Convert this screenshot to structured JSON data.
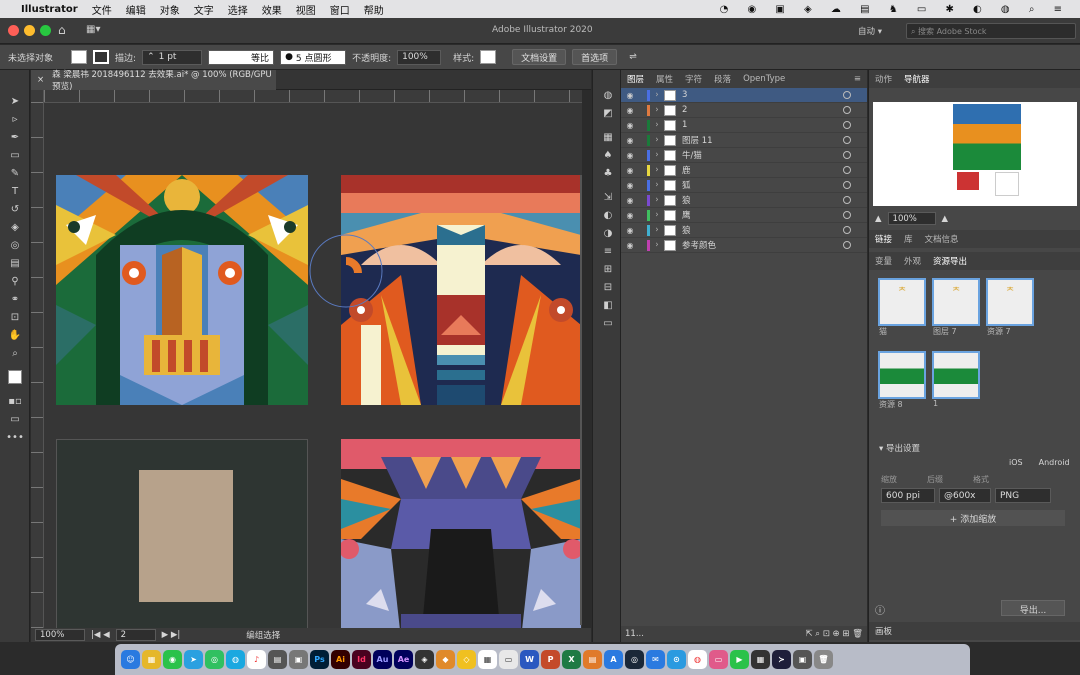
{
  "menubar": {
    "app_name": "Illustrator",
    "items": [
      "文件",
      "编辑",
      "对象",
      "文字",
      "选择",
      "效果",
      "视图",
      "窗口",
      "帮助"
    ]
  },
  "window": {
    "title": "Adobe Illustrator 2020",
    "workspace": "自动",
    "search_placeholder": "搜索 Adobe Stock"
  },
  "control_bar": {
    "selection": "未选择对象",
    "stroke_label": "描边:",
    "stroke_value": "1 pt",
    "stroke_style": "等比",
    "brush": "5 点圆形",
    "opacity_label": "不透明度:",
    "opacity_value": "100%",
    "style_label": "样式:",
    "doc_settings": "文档设置",
    "preferences": "首选项"
  },
  "document_tab": {
    "title": "森 梁晨祎 2018496112 去效果.ai* @ 100% (RGB/GPU 预览)"
  },
  "status_bar": {
    "zoom": "100%",
    "artboard": "2",
    "status": "编组选择"
  },
  "layers_panel": {
    "tabs": [
      "图层",
      "属性",
      "字符",
      "段落",
      "OpenType"
    ],
    "layers": [
      {
        "name": "3",
        "color": "#4a6fe3"
      },
      {
        "name": "2",
        "color": "#e07a40"
      },
      {
        "name": "1",
        "color": "#1a7a3a"
      },
      {
        "name": "图层 11",
        "color": "#1a7a3a"
      },
      {
        "name": "牛/猫",
        "color": "#4a6fe3"
      },
      {
        "name": "鹿",
        "color": "#e8d840"
      },
      {
        "name": "狐",
        "color": "#4a6fe3"
      },
      {
        "name": "狼",
        "color": "#7a4ad0"
      },
      {
        "name": "鹰",
        "color": "#40c060"
      },
      {
        "name": "狼",
        "color": "#40b0d0"
      },
      {
        "name": "参考颜色",
        "color": "#c040b0"
      }
    ],
    "footer": "11..."
  },
  "right_panel": {
    "top_tabs": [
      "动作",
      "导航器"
    ],
    "nav_zoom": "100%",
    "mid_tabs": [
      "链接",
      "库",
      "文档信息"
    ],
    "sub_tabs": [
      "变量",
      "外观",
      "资源导出"
    ],
    "assets": [
      "猫",
      "图层 7",
      "资源 7",
      "资源 8",
      "1"
    ],
    "export_settings": "导出设置",
    "platforms": [
      "iOS",
      "Android"
    ],
    "columns": [
      "缩放",
      "后缀",
      "格式"
    ],
    "scale": "600 ppi",
    "suffix": "@600x",
    "format": "PNG",
    "add_scale": "+ 添加缩放",
    "export_button": "导出...",
    "artboard_tab": "画板"
  },
  "dock": {
    "apps": [
      "Ps",
      "Ai",
      "Id",
      "Au",
      "Ae"
    ]
  }
}
